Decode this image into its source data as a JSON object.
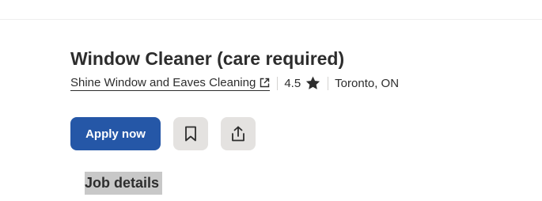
{
  "job": {
    "title": "Window Cleaner (care required)",
    "company": "Shine Window and Eaves Cleaning",
    "rating": "4.5",
    "location": "Toronto, ON"
  },
  "actions": {
    "apply_label": "Apply now",
    "save_icon": "bookmark-icon",
    "share_icon": "share-icon"
  },
  "sections": {
    "job_details_heading": "Job details"
  },
  "colors": {
    "primary": "#2557a7",
    "text": "#2d2d2d",
    "icon_button_bg": "#e4e2e0",
    "heading_highlight": "#c8c8c8"
  }
}
